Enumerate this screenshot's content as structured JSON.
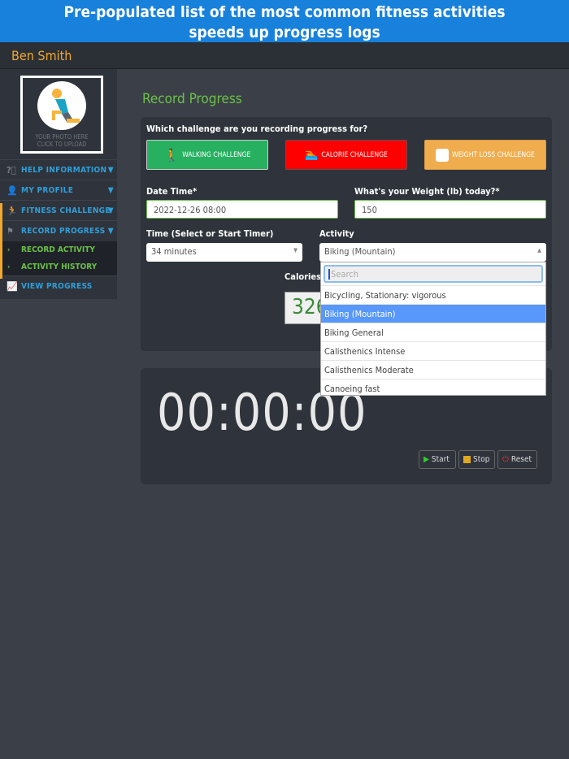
{
  "banner": {
    "line1": "Pre-populated list of the most common fitness activities",
    "line2": "speeds up progress logs"
  },
  "user": {
    "name": "Ben Smith"
  },
  "photo": {
    "line1": "YOUR PHOTO HERE",
    "line2": "CLICK TO UPLOAD"
  },
  "sidebar": {
    "items": [
      {
        "label": "HELP INFORMATION"
      },
      {
        "label": "MY PROFILE"
      },
      {
        "label": "FITNESS CHALLENGE"
      },
      {
        "label": "RECORD PROGRESS"
      }
    ],
    "sub": [
      {
        "label": "RECORD ACTIVITY"
      },
      {
        "label": "ACTIVITY HISTORY"
      }
    ],
    "view": "VIEW PROGRESS"
  },
  "page": {
    "title": "Record Progress"
  },
  "form": {
    "question": "Which challenge are you recording progress for?",
    "challenges": [
      {
        "label": "WALKING CHALLENGE",
        "color": "#27b060"
      },
      {
        "label": "CALORIE CHALLENGE",
        "color": "#ff0000"
      },
      {
        "label": "WEIGHT LOSS CHALLENGE",
        "color": "#f0ad4e"
      }
    ],
    "date_label": "Date Time*",
    "date_value": "2022-12-26 08:00",
    "weight_label": "What's your Weight (lb) today?*",
    "weight_value": "150",
    "time_label": "Time (Select or Start Timer)",
    "time_value": "34 minutes",
    "activity_label": "Activity",
    "activity_value": "Biking (Mountain)",
    "calories_label": "Calories",
    "calories_value": "326",
    "search_placeholder": "Search",
    "options": [
      "Bicycling, Stationary: vigorous",
      "Biking (Mountain)",
      "Biking General",
      "Calisthenics Intense",
      "Calisthenics Moderate",
      "Canoeing fast"
    ]
  },
  "timer": {
    "display": "00:00:00",
    "start": "Start",
    "stop": "Stop",
    "reset": "Reset"
  }
}
